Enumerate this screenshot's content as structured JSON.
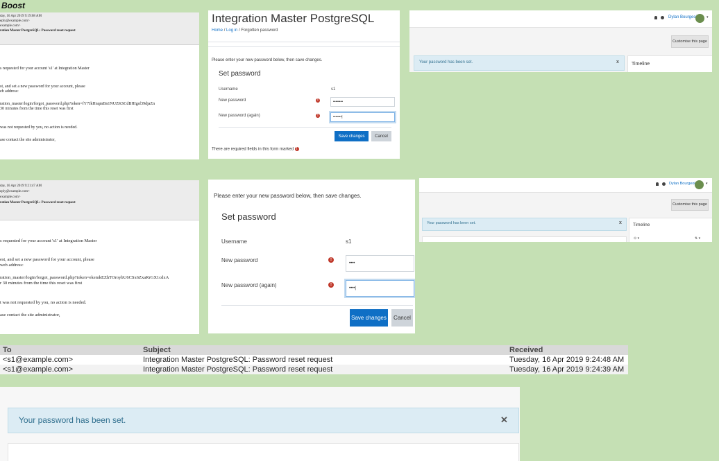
{
  "heading": "Boost",
  "email1": {
    "header": [
      "day, 16 Apr 2019 9:19:08 AM",
      "eply@example.com>",
      "example.com>",
      "ration Master PostgreSQL: Password reset request"
    ],
    "body": [
      "s requested for your account 's1' at Integration Master",
      "st, and set a new password for your account, please",
      "eb address:",
      "ration_master/login/forgot_password.php?token=fY7JkHnqmBn1NUZKSCdBHIgsf39djaZn",
      " 30 minutes from the time this reset was first",
      "was not requested by you, no action is needed.",
      "ase contact the site administrator,"
    ]
  },
  "email2": {
    "header": [
      "day, 16 Apr 2019 9:21:47 AM",
      "eply@example.com>",
      "example.com>",
      "ration Master PostgreSQL: Password reset request"
    ],
    "body": [
      "s requested for your account 's1' at Integration Master",
      "est, and set a new password for your account, please",
      "web address:",
      "ration_master/login/forgot_password.php?token=ekemkEZhTOroybU6CSx6ZxaRrGX1cdxA",
      "r 30 minutes from the time this reset was first",
      "t was not requested by you, no action is needed.",
      "ase contact the site administrator,"
    ]
  },
  "form1": {
    "site_title": "Integration Master PostgreSQL",
    "breadcrumb": {
      "home": "Home",
      "sep1": "/",
      "login": "Log in",
      "sep2": "/",
      "current": "Forgotten password"
    },
    "instruction": "Please enter your new password below, then save changes.",
    "section_title": "Set password",
    "username_label": "Username",
    "username_value": "s1",
    "new_password_label": "New password",
    "new_password_value": "••••••••",
    "new_password_again_label": "New password (again)",
    "new_password_again_value": "•••••••|",
    "save_label": "Save changes",
    "cancel_label": "Cancel",
    "required_note": "There are required fields in this form marked"
  },
  "form2": {
    "instruction": "Please enter your new password below, then save changes.",
    "section_title": "Set password",
    "username_label": "Username",
    "username_value": "s1",
    "new_password_label": "New password",
    "new_password_value": "••••",
    "new_password_again_label": "New password (again)",
    "new_password_again_value": "••••|",
    "save_label": "Save changes",
    "cancel_label": "Cancel"
  },
  "dash1": {
    "user_name": "Dylan Bourgeois",
    "customise_label": "Customise this page",
    "alert_text": "Your password has been set.",
    "close_glyph": "x",
    "timeline_label": "Timeline"
  },
  "dash2": {
    "user_name": "Dylan Bourgeois",
    "customise_label": "Customise this page",
    "alert_text": "Your password has been set.",
    "close_glyph": "x",
    "timeline_label": "Timeline",
    "timeline_filter": "⊙ ▾",
    "timeline_sort": "⇅ ▾"
  },
  "mail_table": {
    "columns": [
      "To",
      "Subject",
      "Received"
    ],
    "rows": [
      {
        "to": "<s1@example.com>",
        "subject": "Integration Master PostgreSQL: Password reset request",
        "received": "Tuesday, 16 Apr 2019 9:24:48 AM"
      },
      {
        "to": "<s1@example.com>",
        "subject": "Integration Master PostgreSQL: Password reset request",
        "received": "Tuesday, 16 Apr 2019 9:24:39 AM"
      }
    ]
  },
  "big_alert": {
    "text": "Your password has been set.",
    "close_glyph": "✕"
  },
  "icons": {
    "required": "!",
    "bell": "🔔",
    "chat": "●",
    "caret": "▾"
  },
  "colors": {
    "background": "#c5e0b4",
    "primary": "#0f6fc5",
    "alert_bg": "#dcecf4",
    "alert_text": "#31708f",
    "required": "#c0392b"
  }
}
